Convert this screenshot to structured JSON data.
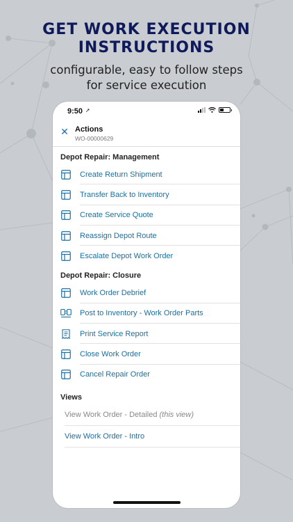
{
  "headline": {
    "line1": "GET WORK EXECUTION",
    "line2": "INSTRUCTIONS"
  },
  "subline": {
    "line1": "configurable, easy to follow steps",
    "line2": "for service execution"
  },
  "status_bar": {
    "time": "9:50",
    "location_glyph": "➚"
  },
  "header": {
    "close_glyph": "✕",
    "title": "Actions",
    "subtitle": "WO-00000629"
  },
  "sections": [
    {
      "title": "Depot Repair: Management",
      "items": [
        {
          "label": "Create Return Shipment",
          "icon": "table-icon"
        },
        {
          "label": "Transfer Back to Inventory",
          "icon": "table-icon"
        },
        {
          "label": "Create Service Quote",
          "icon": "table-icon"
        },
        {
          "label": "Reassign Depot Route",
          "icon": "table-icon"
        },
        {
          "label": "Escalate Depot Work Order",
          "icon": "table-icon"
        }
      ]
    },
    {
      "title": "Depot Repair: Closure",
      "items": [
        {
          "label": "Work Order Debrief",
          "icon": "table-icon"
        },
        {
          "label": "Post to Inventory - Work Order Parts",
          "icon": "transfer-icon"
        },
        {
          "label": "Print Service Report",
          "icon": "report-icon"
        },
        {
          "label": "Close Work Order",
          "icon": "table-icon"
        },
        {
          "label": "Cancel Repair Order",
          "icon": "table-icon"
        }
      ]
    }
  ],
  "views": {
    "title": "Views",
    "current_label": "View Work Order - Detailed",
    "current_hint": "(this view)",
    "other_label": "View Work Order - Intro"
  },
  "colors": {
    "accent": "#1a6fa0",
    "headline": "#0f1a5a",
    "background": "#c9cdd1"
  }
}
